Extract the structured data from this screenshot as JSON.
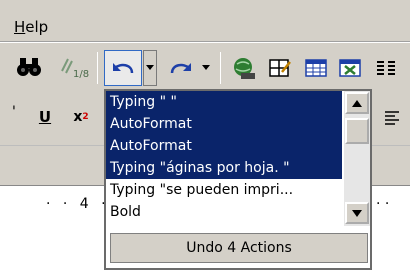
{
  "menu": {
    "help_first": "H",
    "help_rest": "elp"
  },
  "toolbar": {
    "find_icon": "binoculars-icon",
    "undo_icon": "undo-arrow-icon",
    "redo_icon": "redo-arrow-icon",
    "underline_label": "U",
    "superscript_label": "x"
  },
  "ruler": {
    "left_text": "· · 4 · ·",
    "right_text": "· ·"
  },
  "undo_list": {
    "items": [
      {
        "label": "Typing \" \"",
        "selected": true
      },
      {
        "label": "AutoFormat",
        "selected": true
      },
      {
        "label": "AutoFormat",
        "selected": true
      },
      {
        "label": "Typing \"áginas por hoja. \"",
        "selected": true
      },
      {
        "label": "Typing \"se pueden impri...",
        "selected": false
      },
      {
        "label": "Bold",
        "selected": false
      }
    ],
    "footer": "Undo 4 Actions"
  },
  "colors": {
    "selection": "#0a246a",
    "chrome": "#d4d0c8"
  }
}
